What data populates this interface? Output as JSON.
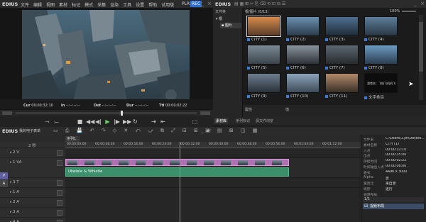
{
  "app": {
    "logo": "EDIUS",
    "menu": [
      "文件",
      "编辑",
      "视图",
      "素材",
      "标记",
      "模式",
      "采集",
      "渲染",
      "工具",
      "设置",
      "帮助",
      "试用版"
    ],
    "plr": "PLR",
    "rec": "REC"
  },
  "preview": {
    "cur_label": "Cur",
    "cur": "00:00:32:10",
    "in_label": "In",
    "in": "--:--:--:--",
    "out_label": "Out",
    "out": "--:--:--:--",
    "dur_label": "Dur",
    "dur": "--:--:--:--",
    "ttl_label": "Ttl",
    "ttl": "00:00:02:22"
  },
  "bin": {
    "logo": "EDIUS",
    "folder_tab": "文件夹",
    "root": "根",
    "child": "图片",
    "path": "根/图片 (0/13)",
    "zoom": "100%",
    "items": [
      "CITY (1)",
      "CITY (2)",
      "CITY (3)",
      "CITY (4)",
      "CITY (5)",
      "CITY (6)",
      "CITY (7)",
      "CITY (8)",
      "CITY (9)",
      "CITY (10)",
      "CITY (11)",
      "文字条目"
    ],
    "text_clip": "游戏名：飞机飞机机飞",
    "attrib_label": "属性",
    "attrib_sub": "值",
    "tabs": [
      "素材库",
      "序列标记",
      "源文件浏览"
    ]
  },
  "timeline": {
    "logo": "EDIUS",
    "project": "我的电子表单",
    "seq_tab": "序列1",
    "zoom": "2 秒",
    "ruler": [
      "00:00:00:00",
      "00:00:08:00",
      "00:00:16:00",
      "00:00:24:00",
      "00:00:32:00",
      "00:00:40:00",
      "00:00:48:00",
      "00:00:56:00",
      "00:01:04:00",
      "00:01:12:00"
    ],
    "tracks": [
      "2 V",
      "1 VA",
      "3 T",
      "1 A",
      "2 A",
      "3 A",
      "4 A"
    ],
    "vlabel": "V",
    "alabel": "A",
    "audio_clip": "Ukelele & Whistle"
  },
  "info": {
    "props": [
      {
        "k": "文件名",
        "v": "C:\\Users\\1.jifi\\Deskto..."
      },
      {
        "k": "素材名称",
        "v": "CITY (1)"
      },
      {
        "k": "入点",
        "v": "00:00:32:10"
      },
      {
        "k": "出点",
        "v": "00:00:35:00"
      },
      {
        "k": "持续时间",
        "v": "00:00:02:22"
      },
      {
        "k": "时间轴出入点",
        "v": "00:00:06:00"
      },
      {
        "k": "格式",
        "v": "4496 x 3000"
      },
      {
        "k": "Alpha",
        "v": "否"
      },
      {
        "k": "宽高比",
        "v": "来自源"
      },
      {
        "k": "场序",
        "v": "逐行"
      },
      {
        "k": "视频布局",
        "v": ""
      }
    ],
    "page": "1/1",
    "effect": "视频布局"
  },
  "colors": {
    "accent": "#3d7bd8",
    "clip_video": "#b071b3",
    "clip_audio": "#3b8f6b",
    "rec": "#2c6fd6",
    "playhead": "#4fa3ff"
  }
}
